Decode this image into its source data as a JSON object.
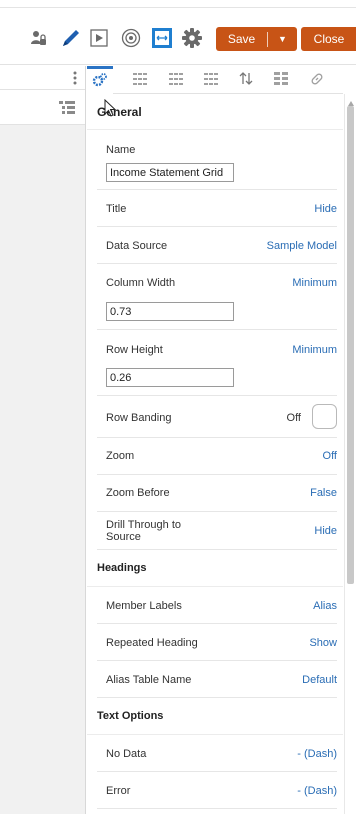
{
  "toolbar": {
    "save_label": "Save",
    "close_label": "Close",
    "icons": [
      "user-lock-icon",
      "pencil-icon",
      "play-icon",
      "target-icon",
      "fit-width-icon",
      "gear-icon"
    ],
    "accent": "#c85416"
  },
  "tabs": [
    "settings-tab",
    "grid-layout-tab",
    "grid-tab-2",
    "grid-tab-3",
    "sort-tab",
    "layout-tab",
    "link-tab"
  ],
  "sections": {
    "general": "General",
    "headings": "Headings",
    "text_options": "Text Options"
  },
  "properties": {
    "name": {
      "label": "Name",
      "value": "Income Statement Grid"
    },
    "title": {
      "label": "Title",
      "value": "Hide"
    },
    "data_source": {
      "label": "Data Source",
      "value": "Sample Model"
    },
    "column_width": {
      "label": "Column Width",
      "value": "Minimum",
      "input": "0.73"
    },
    "row_height": {
      "label": "Row Height",
      "value": "Minimum",
      "input": "0.26"
    },
    "row_banding": {
      "label": "Row Banding",
      "value": "Off"
    },
    "zoom": {
      "label": "Zoom",
      "value": "Off"
    },
    "zoom_before": {
      "label": "Zoom Before",
      "value": "False"
    },
    "drill_through": {
      "label_line1": "Drill Through to",
      "label_line2": "Source",
      "value": "Hide"
    },
    "member_labels": {
      "label": "Member Labels",
      "value": "Alias"
    },
    "repeated_heading": {
      "label": "Repeated Heading",
      "value": "Show"
    },
    "alias_table_name": {
      "label": "Alias Table Name",
      "value": "Default"
    },
    "no_data": {
      "label": "No Data",
      "value": "- (Dash)"
    },
    "error": {
      "label": "Error",
      "value": "- (Dash)"
    }
  }
}
